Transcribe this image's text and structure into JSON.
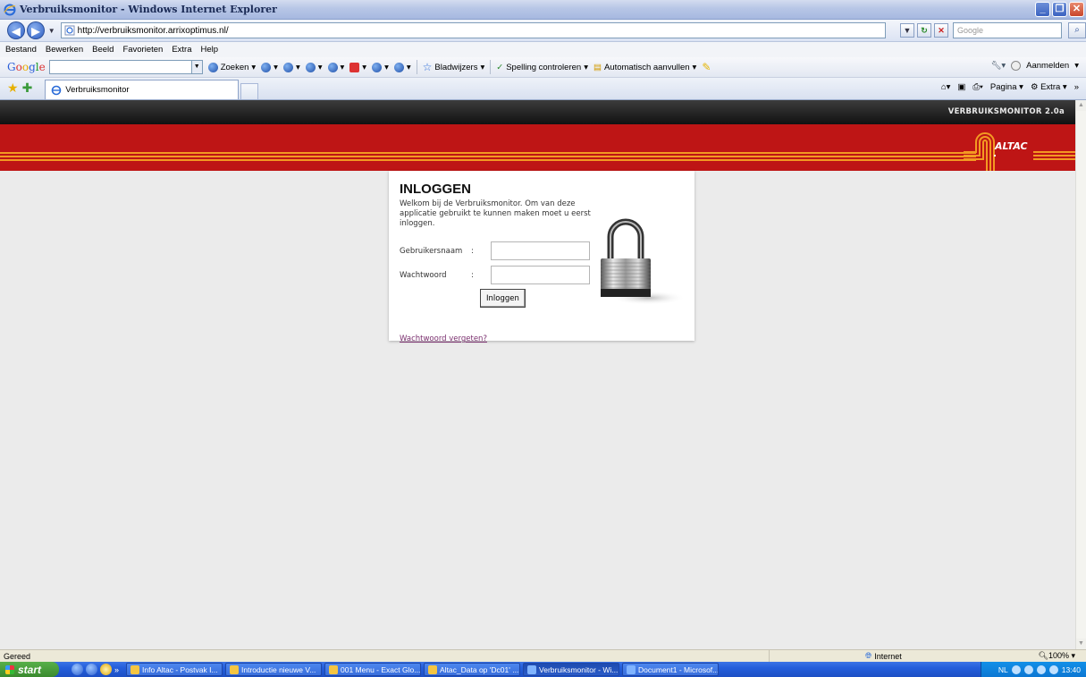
{
  "window": {
    "title": "Verbruiksmonitor - Windows Internet Explorer",
    "buttons": [
      "_",
      "❐",
      "✕"
    ]
  },
  "address": {
    "url": "http://verbruiksmonitor.arrixoptimus.nl/",
    "search_placeholder": "Google"
  },
  "menu": {
    "items": [
      "Bestand",
      "Bewerken",
      "Beeld",
      "Favorieten",
      "Extra",
      "Help"
    ]
  },
  "google_toolbar": {
    "search_label": "Zoeken",
    "bookmarks_label": "Bladwijzers",
    "spelling_label": "Spelling controleren",
    "autofill_label": "Automatisch aanvullen",
    "signin_label": "Aanmelden"
  },
  "tabs": {
    "active_tab": "Verbruiksmonitor",
    "page_label": "Pagina",
    "extra_label": "Extra"
  },
  "site": {
    "version": "VERBRUIKSMONITOR 2.0a",
    "logo_text": "ALTAC"
  },
  "login": {
    "heading": "INLOGGEN",
    "intro": "Welkom bij de Verbruiksmonitor. Om van deze applicatie gebruikt te kunnen maken moet u eerst inloggen.",
    "username_label": "Gebruikersnaam",
    "password_label": "Wachtwoord",
    "colon": ":",
    "username_value": "",
    "password_value": "",
    "submit_label": "Inloggen",
    "forgot_label": "Wachtwoord vergeten?"
  },
  "status": {
    "text": "Gereed",
    "zone": "Internet",
    "zoom": "100%"
  },
  "taskbar": {
    "start_label": "start",
    "items": [
      "Info Altac - Postvak I...",
      "Introductie nieuwe V...",
      "001 Menu - Exact Glo...",
      "Altac_Data op 'Dc01' ...",
      "Verbruiksmonitor - Wi...",
      "Document1 - Microsof..."
    ],
    "active_item": "Verbruiksmonitor - Wi...",
    "tray_lang": "NL",
    "clock": "13:40"
  },
  "colors": {
    "banner_red": "#be1515",
    "stripe_orange": "#f39a22",
    "link_purple": "#7a2f6e"
  }
}
